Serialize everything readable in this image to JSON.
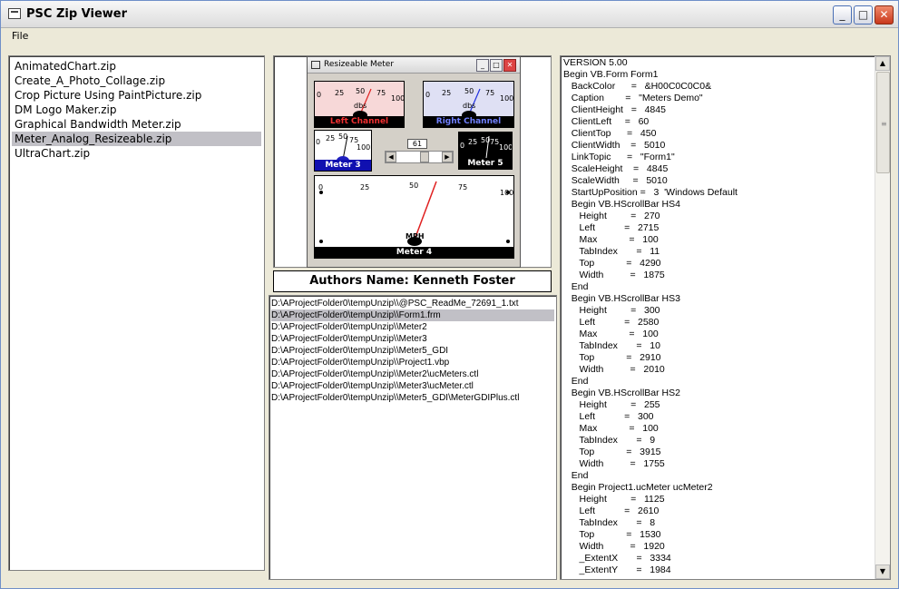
{
  "window": {
    "title": "PSC Zip Viewer"
  },
  "menu": {
    "file": "File"
  },
  "zip_list": [
    "AnimatedChart.zip",
    "Create_A_Photo_Collage.zip",
    "Crop Picture Using PaintPicture.zip",
    "DM Logo Maker.zip",
    "Graphical Bandwidth Meter.zip",
    "Meter_Analog_Resizeable.zip",
    "UltraChart.zip"
  ],
  "preview": {
    "window_title": "Resizeable Meter",
    "meters": {
      "left": {
        "label": "Left Channel",
        "unit": "dbs",
        "ticks": [
          "0",
          "25",
          "50",
          "75",
          "100"
        ]
      },
      "right": {
        "label": "Right Channel",
        "unit": "dbs",
        "ticks": [
          "0",
          "25",
          "50",
          "75",
          "100"
        ]
      },
      "m3": {
        "label": "Meter 3",
        "ticks": [
          "0",
          "25",
          "50",
          "75",
          "100"
        ]
      },
      "m5": {
        "label": "Meter 5",
        "ticks": [
          "0",
          "25",
          "50",
          "75",
          "100"
        ]
      },
      "m4": {
        "label": "Meter 4",
        "unit": "MPH",
        "ticks": [
          "0",
          "25",
          "50",
          "75",
          "100"
        ]
      }
    },
    "slider_value": "61"
  },
  "author": "Authors Name: Kenneth Foster",
  "files": [
    "D:\\AProjectFolder0\\tempUnzip\\\\@PSC_ReadMe_72691_1.txt",
    "D:\\AProjectFolder0\\tempUnzip\\\\Form1.frm",
    "D:\\AProjectFolder0\\tempUnzip\\\\Meter2",
    "D:\\AProjectFolder0\\tempUnzip\\\\Meter3",
    "D:\\AProjectFolder0\\tempUnzip\\\\Meter5_GDI",
    "D:\\AProjectFolder0\\tempUnzip\\\\Project1.vbp",
    "D:\\AProjectFolder0\\tempUnzip\\\\Meter2\\ucMeters.ctl",
    "D:\\AProjectFolder0\\tempUnzip\\\\Meter3\\ucMeter.ctl",
    "D:\\AProjectFolder0\\tempUnzip\\\\Meter5_GDI\\MeterGDIPlus.ctl"
  ],
  "code_lines": [
    "VERSION 5.00",
    "Begin VB.Form Form1",
    "   BackColor      =   &H00C0C0C0&",
    "   Caption        =   \"Meters Demo\"",
    "   ClientHeight   =   4845",
    "   ClientLeft     =   60",
    "   ClientTop      =   450",
    "   ClientWidth    =   5010",
    "   LinkTopic      =   \"Form1\"",
    "   ScaleHeight    =   4845",
    "   ScaleWidth     =   5010",
    "   StartUpPosition =   3  'Windows Default",
    "   Begin VB.HScrollBar HS4",
    "      Height         =   270",
    "      Left           =   2715",
    "      Max            =   100",
    "      TabIndex       =   11",
    "      Top            =   4290",
    "      Width          =   1875",
    "   End",
    "   Begin VB.HScrollBar HS3",
    "      Height         =   300",
    "      Left           =   2580",
    "      Max            =   100",
    "      TabIndex       =   10",
    "      Top            =   2910",
    "      Width          =   2010",
    "   End",
    "   Begin VB.HScrollBar HS2",
    "      Height         =   255",
    "      Left           =   300",
    "      Max            =   100",
    "      TabIndex       =   9",
    "      Top            =   3915",
    "      Width          =   1755",
    "   End",
    "   Begin Project1.ucMeter ucMeter2",
    "      Height         =   1125",
    "      Left           =   2610",
    "      TabIndex       =   8",
    "      Top            =   1530",
    "      Width          =   1920",
    "      _ExtentX       =   3334",
    "      _ExtentY       =   1984"
  ],
  "selected_zip_index": 5,
  "selected_file_index": 1
}
